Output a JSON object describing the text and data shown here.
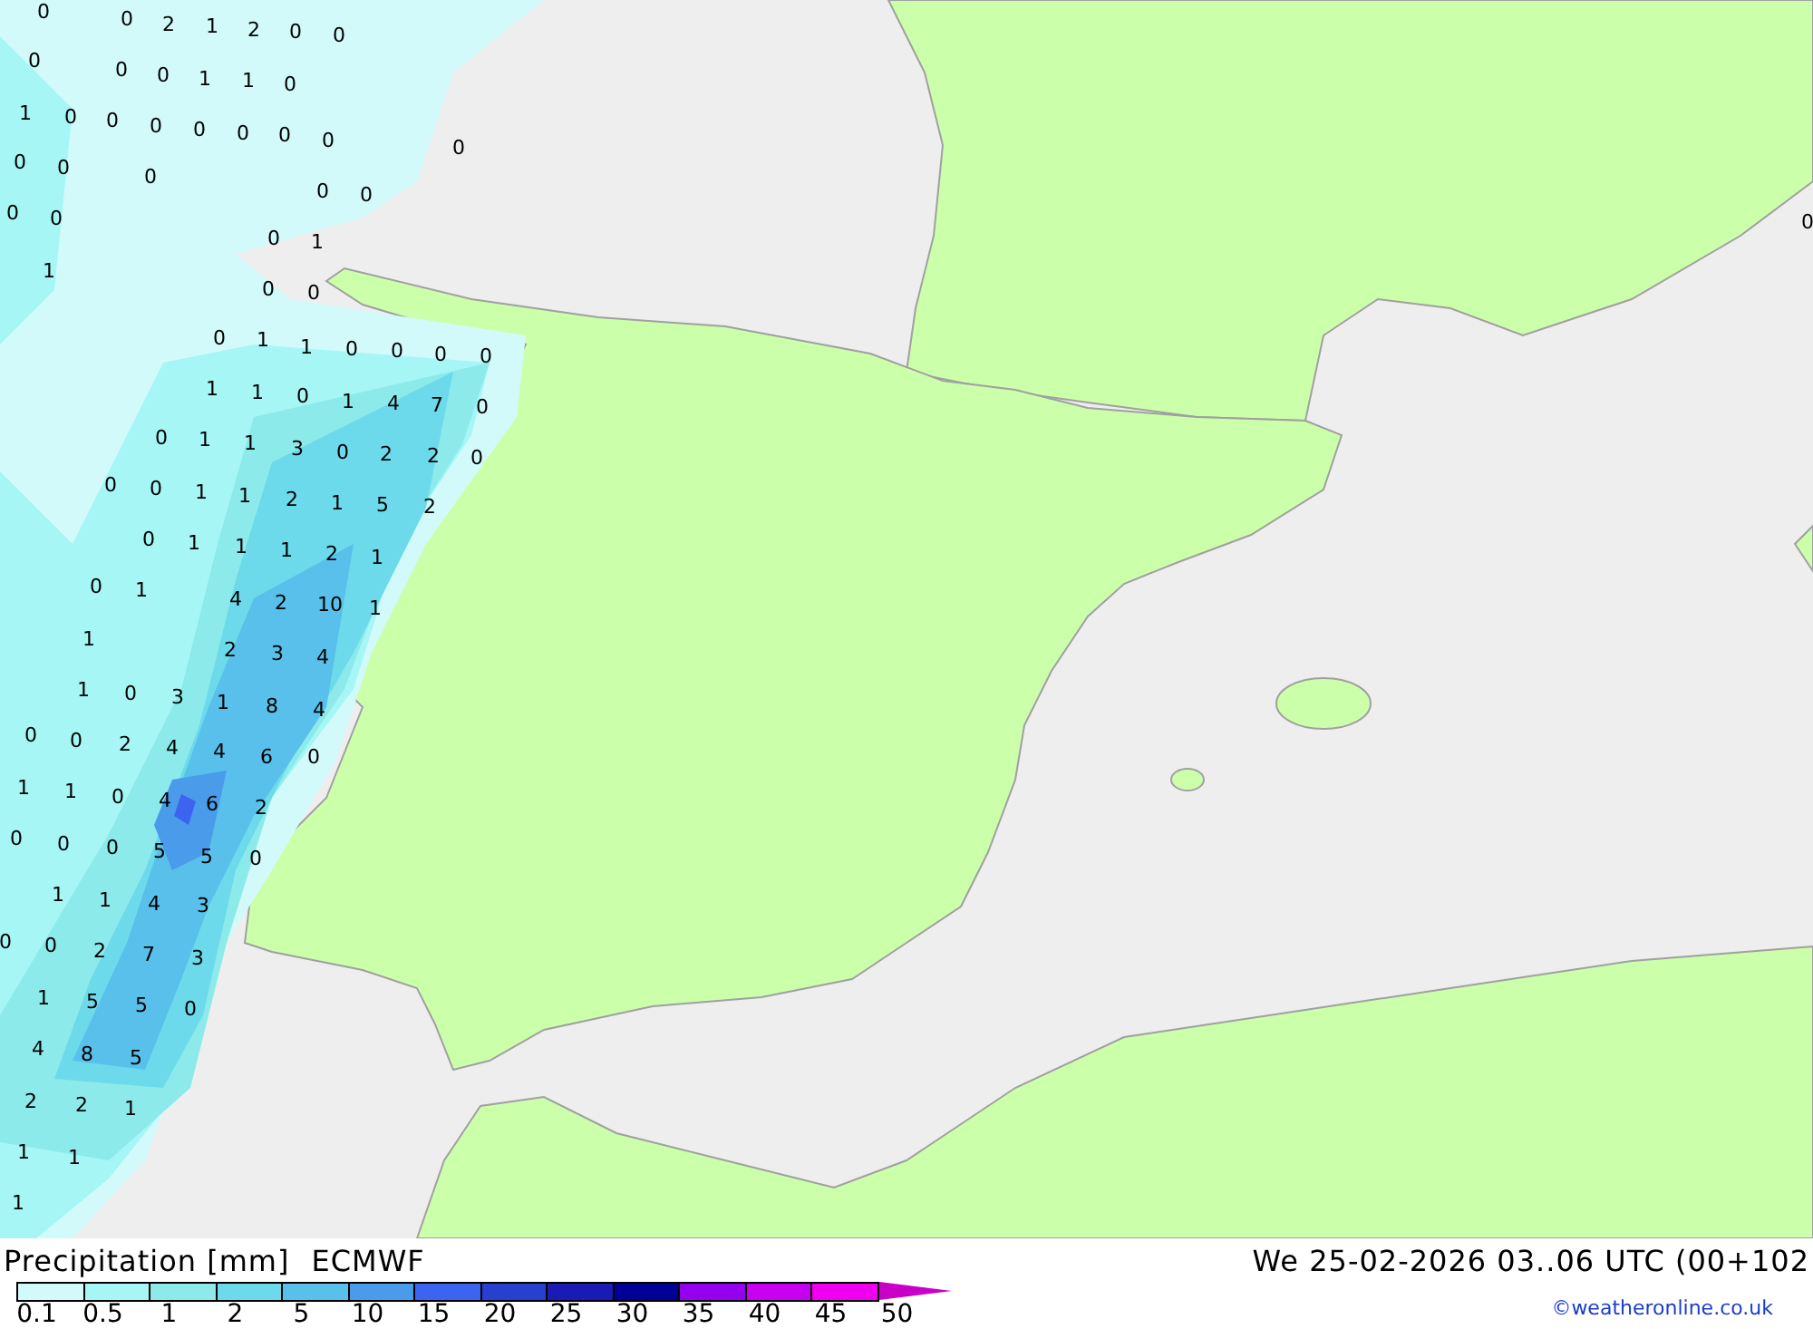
{
  "map": {
    "labels": [
      "0",
      "0",
      "2",
      "1",
      "2",
      "0",
      "0",
      "0",
      "0",
      "0",
      "1",
      "1",
      "0",
      "1",
      "0",
      "0",
      "0",
      "0",
      "0",
      "0",
      "0",
      "0",
      "0",
      "0",
      "0",
      "0",
      "0",
      "0",
      "0",
      "0",
      "1",
      "1",
      "0",
      "0",
      "0",
      "0",
      "1",
      "1",
      "0",
      "0",
      "0",
      "0",
      "1",
      "1",
      "0",
      "1",
      "4",
      "7",
      "0",
      "0",
      "1",
      "1",
      "3",
      "0",
      "2",
      "2",
      "0",
      "0",
      "0",
      "1",
      "1",
      "2",
      "1",
      "5",
      "2",
      "0",
      "1",
      "1",
      "1",
      "2",
      "1",
      "0",
      "1",
      "4",
      "2",
      "10",
      "1",
      "1",
      "2",
      "3",
      "4",
      "1",
      "0",
      "3",
      "1",
      "8",
      "4",
      "0",
      "0",
      "2",
      "4",
      "4",
      "6",
      "0",
      "1",
      "1",
      "0",
      "4",
      "6",
      "2",
      "0",
      "0",
      "0",
      "5",
      "5",
      "0",
      "1",
      "1",
      "4",
      "3",
      "0",
      "0",
      "2",
      "7",
      "3",
      "1",
      "5",
      "5",
      "0",
      "4",
      "8",
      "5",
      "2",
      "2",
      "1",
      "1",
      "1",
      "1"
    ]
  },
  "footer": {
    "title": "Precipitation [mm]",
    "model": "ECMWF",
    "valid_time": "We 25-02-2026 03..06 UTC (00+102",
    "credit": "©weatheronline.co.uk",
    "legend": [
      {
        "tick": "0.1",
        "color": "#d2fafa"
      },
      {
        "tick": "0.5",
        "color": "#a6f6f6"
      },
      {
        "tick": "1",
        "color": "#8ceaea"
      },
      {
        "tick": "2",
        "color": "#6cdaea"
      },
      {
        "tick": "5",
        "color": "#58c0ea"
      },
      {
        "tick": "10",
        "color": "#4a9cea"
      },
      {
        "tick": "15",
        "color": "#3c64f0"
      },
      {
        "tick": "20",
        "color": "#2840d0"
      },
      {
        "tick": "25",
        "color": "#1a1ab4"
      },
      {
        "tick": "30",
        "color": "#000096"
      },
      {
        "tick": "35",
        "color": "#9600f0"
      },
      {
        "tick": "40",
        "color": "#c800f0"
      },
      {
        "tick": "45",
        "color": "#f000f0"
      },
      {
        "tick": "50",
        "color": "#c800c8"
      }
    ]
  }
}
